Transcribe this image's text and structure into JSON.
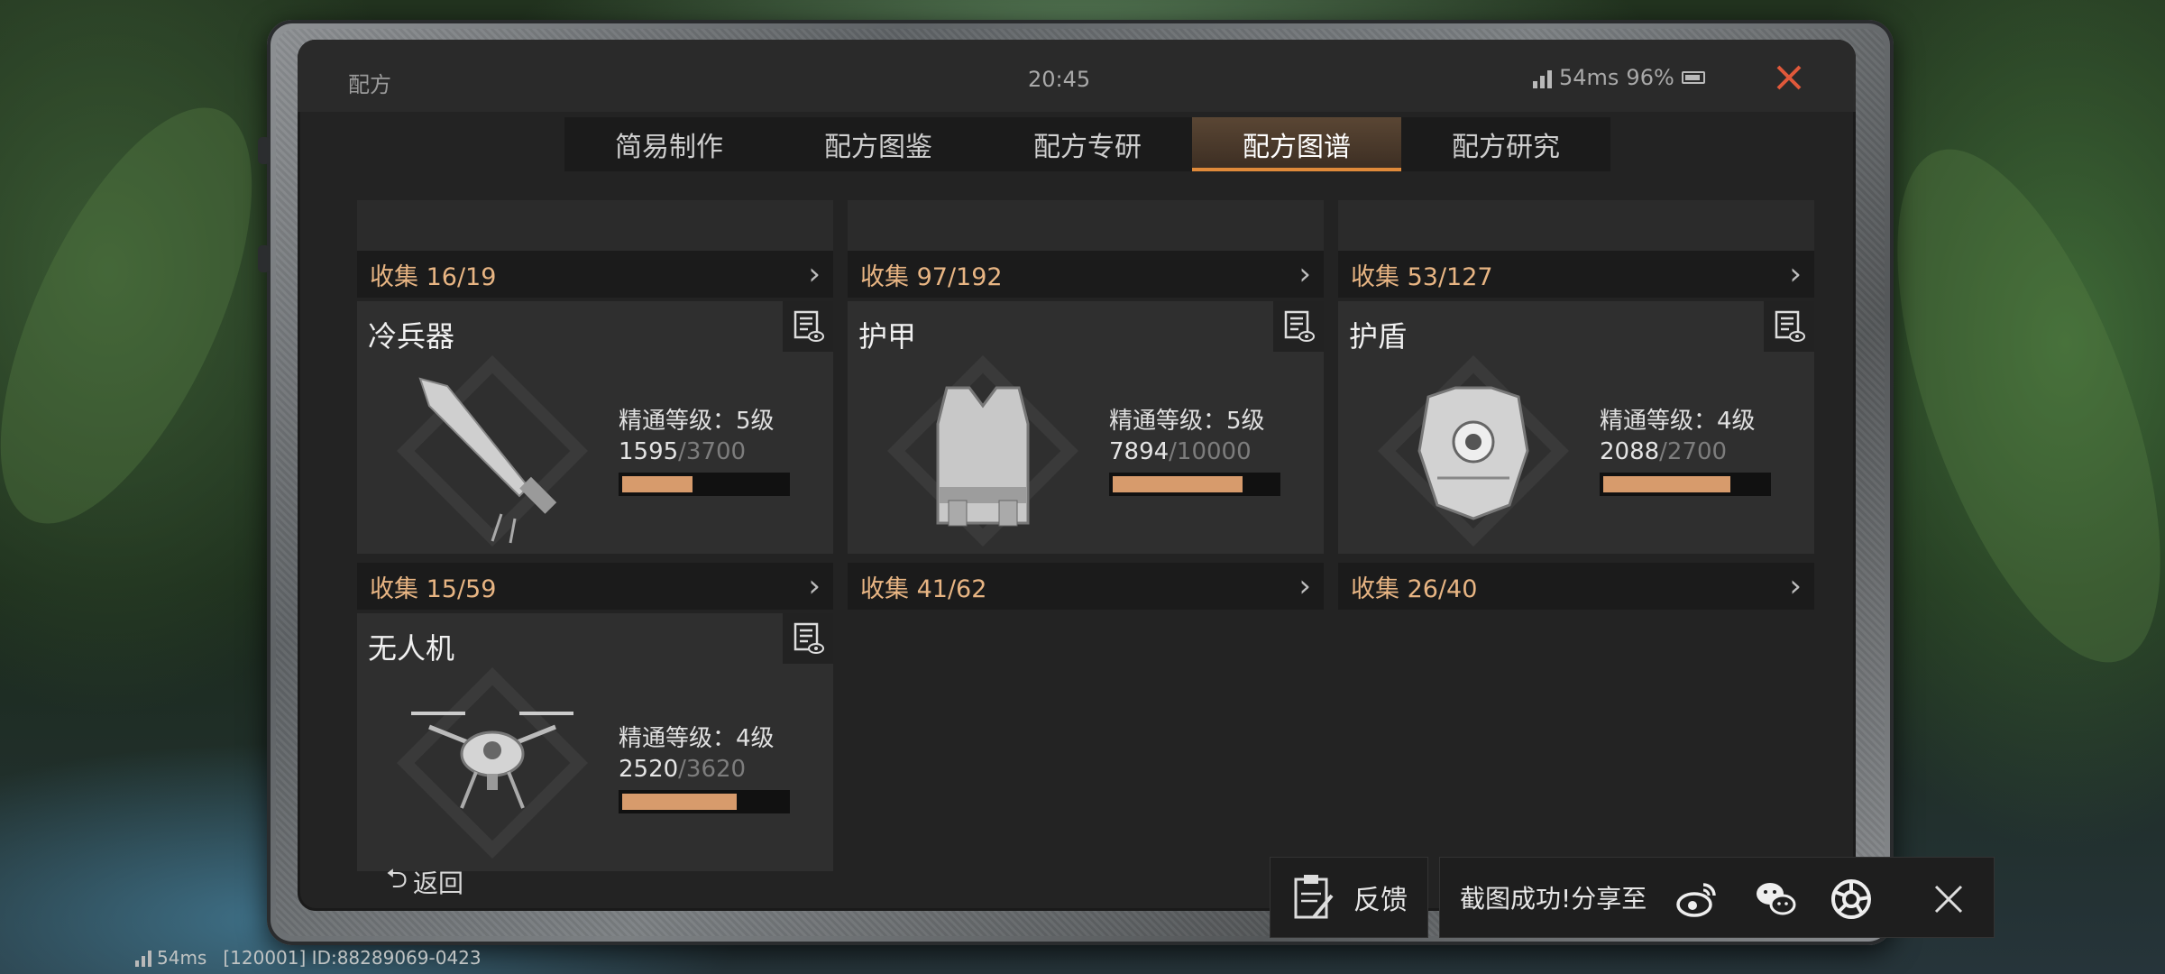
{
  "status_bar": {
    "title": "配方",
    "time": "20:45",
    "latency": "54ms",
    "battery": "96%"
  },
  "tabs": [
    {
      "label": "简易制作",
      "active": false
    },
    {
      "label": "配方图鉴",
      "active": false
    },
    {
      "label": "配方专研",
      "active": false
    },
    {
      "label": "配方图谱",
      "active": true
    },
    {
      "label": "配方研究",
      "active": false
    }
  ],
  "collect_rows": [
    {
      "label": "收集 16/19"
    },
    {
      "label": "收集 97/192"
    },
    {
      "label": "收集 53/127"
    }
  ],
  "cards": [
    {
      "name": "冷兵器",
      "mastery": "精通等级：5级",
      "current": "1595",
      "total": "/3700",
      "progress": 0.431,
      "icon": "sword-icon",
      "collect": "收集 15/59"
    },
    {
      "name": "护甲",
      "mastery": "精通等级：5级",
      "current": "7894",
      "total": "/10000",
      "progress": 0.789,
      "icon": "armor-vest-icon",
      "collect": "收集 41/62"
    },
    {
      "name": "护盾",
      "mastery": "精通等级：4级",
      "current": "2088",
      "total": "/2700",
      "progress": 0.773,
      "icon": "shield-armor-icon",
      "collect": "收集 26/40"
    },
    {
      "name": "无人机",
      "mastery": "精通等级：4级",
      "current": "2520",
      "total": "/3620",
      "progress": 0.696,
      "icon": "drone-icon"
    }
  ],
  "back_label": "返回",
  "feedback_label": "反馈",
  "share_label": "截图成功!分享至",
  "footer": {
    "latency": "54ms",
    "id": "[120001] ID:88289069-0423"
  },
  "colors": {
    "accent": "#e08a3a",
    "collect_text": "#e8b583",
    "bar_fill": "#d79b6c"
  }
}
